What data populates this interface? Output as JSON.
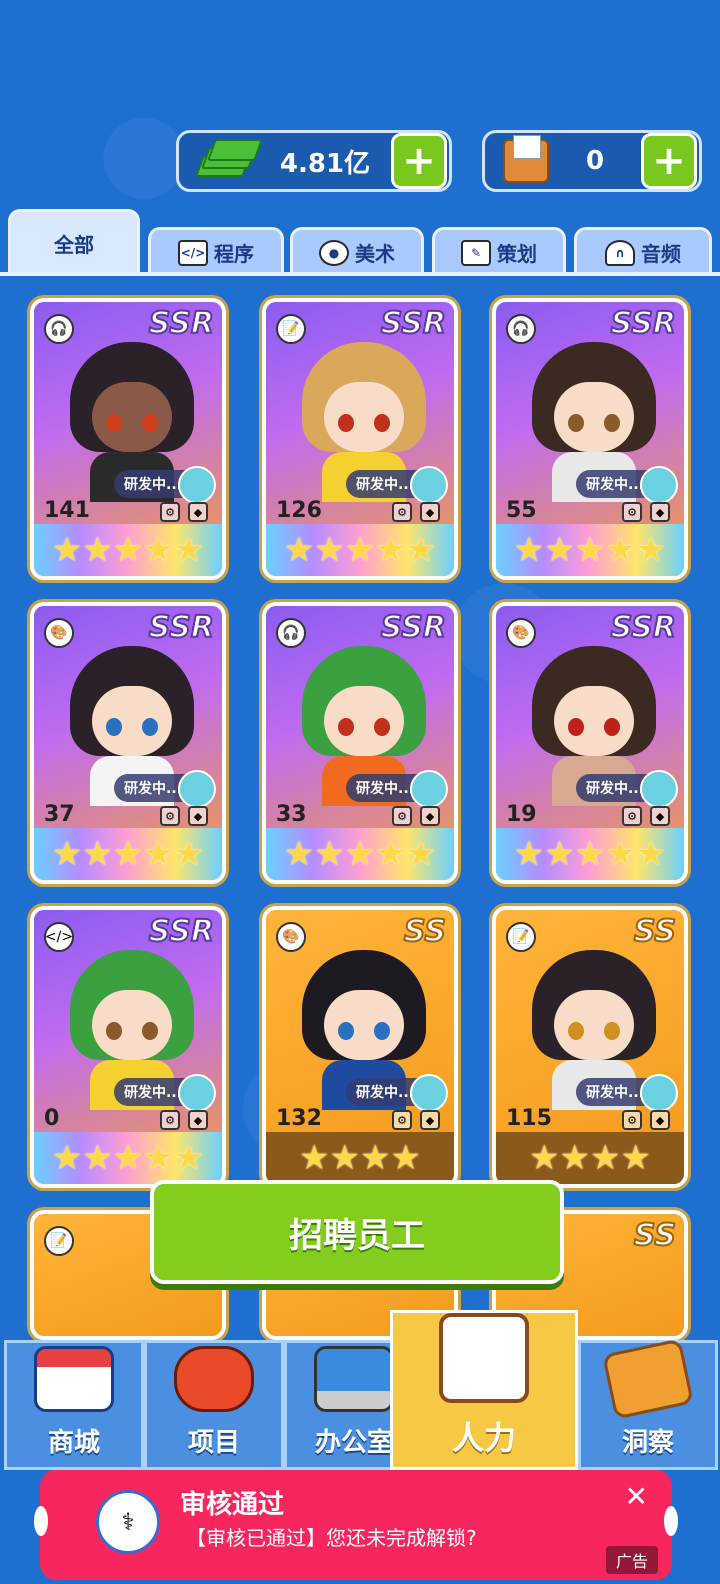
{
  "currency": {
    "money_value": "4.81亿",
    "box_value": "0",
    "plus_label": "+"
  },
  "tabs": [
    {
      "label": "全部",
      "icon": "all"
    },
    {
      "label": "程序",
      "icon": "code-monitor-icon"
    },
    {
      "label": "美术",
      "icon": "palette-icon"
    },
    {
      "label": "策划",
      "icon": "document-pencil-icon"
    },
    {
      "label": "音频",
      "icon": "headphones-icon"
    }
  ],
  "cards": [
    {
      "rarity": "SSR",
      "level": "141",
      "status": "研发中...",
      "role_icon": "headphones-icon",
      "role_glyph": "🎧",
      "stars": "★★★★★",
      "hair": "#2a2228",
      "skin": "#8a5a48",
      "eye": "#d0401a",
      "shirt": "#2a2a2a"
    },
    {
      "rarity": "SSR",
      "level": "126",
      "status": "研发中...",
      "role_icon": "document-icon",
      "role_glyph": "📝",
      "stars": "★★★★★",
      "hair": "#d9a85a",
      "skin": "#f8dcc8",
      "eye": "#c0301a",
      "shirt": "#f4d030"
    },
    {
      "rarity": "SSR",
      "level": "55",
      "status": "研发中...",
      "role_icon": "headphones-icon",
      "role_glyph": "🎧",
      "stars": "★★★★★",
      "hair": "#3a2a22",
      "skin": "#f8dcc8",
      "eye": "#8a5a2a",
      "shirt": "#e8e8e8"
    },
    {
      "rarity": "SSR",
      "level": "37",
      "status": "研发中...",
      "role_icon": "palette-icon",
      "role_glyph": "🎨",
      "stars": "★★★★★",
      "hair": "#2a2228",
      "skin": "#f8dcc8",
      "eye": "#2a70c0",
      "shirt": "#f4f4f4"
    },
    {
      "rarity": "SSR",
      "level": "33",
      "status": "研发中...",
      "role_icon": "headphones-icon",
      "role_glyph": "🎧",
      "stars": "★★★★★",
      "hair": "#3aa040",
      "skin": "#f8dcc8",
      "eye": "#c0301a",
      "shirt": "#f06a20"
    },
    {
      "rarity": "SSR",
      "level": "19",
      "status": "研发中...",
      "role_icon": "palette-icon",
      "role_glyph": "🎨",
      "stars": "★★★★★",
      "hair": "#3a2a22",
      "skin": "#f8dcc8",
      "eye": "#c0201a",
      "shirt": "#d8a890"
    },
    {
      "rarity": "SSR",
      "level": "0",
      "status": "研发中...",
      "role_icon": "code-monitor-icon",
      "role_glyph": "</>",
      "stars": "★★★★★",
      "hair": "#3aa040",
      "skin": "#f8dcc8",
      "eye": "#8a5a2a",
      "shirt": "#f4d030"
    },
    {
      "rarity": "SS",
      "level": "132",
      "status": "研发中...",
      "role_icon": "palette-icon",
      "role_glyph": "🎨",
      "stars": "★★★★",
      "hair": "#1e1a22",
      "skin": "#f8dcc8",
      "eye": "#2a70c0",
      "shirt": "#1e4aa0"
    },
    {
      "rarity": "SS",
      "level": "115",
      "status": "研发中...",
      "role_icon": "document-icon",
      "role_glyph": "📝",
      "stars": "★★★★",
      "hair": "#2a2228",
      "skin": "#f8dcc8",
      "eye": "#d09020",
      "shirt": "#e8e8e8"
    }
  ],
  "recruit_button": "招聘员工",
  "bottom_nav": [
    {
      "label": "商城",
      "icon": "shop-icon"
    },
    {
      "label": "项目",
      "icon": "gamepad-icon"
    },
    {
      "label": "办公室",
      "icon": "laptop-icon"
    },
    {
      "label": "人力",
      "icon": "clipboard-icon"
    },
    {
      "label": "洞察",
      "icon": "news-icon"
    }
  ],
  "ad": {
    "title": "审核通过",
    "subtitle": "【审核已通过】您还未完成解锁?",
    "close": "✕",
    "tag": "广告"
  },
  "colors": {
    "background": "#1e6fd0",
    "recruit_button": "#82cd1e",
    "active_nav": "#f7c843",
    "ad_background": "#f7275e"
  }
}
